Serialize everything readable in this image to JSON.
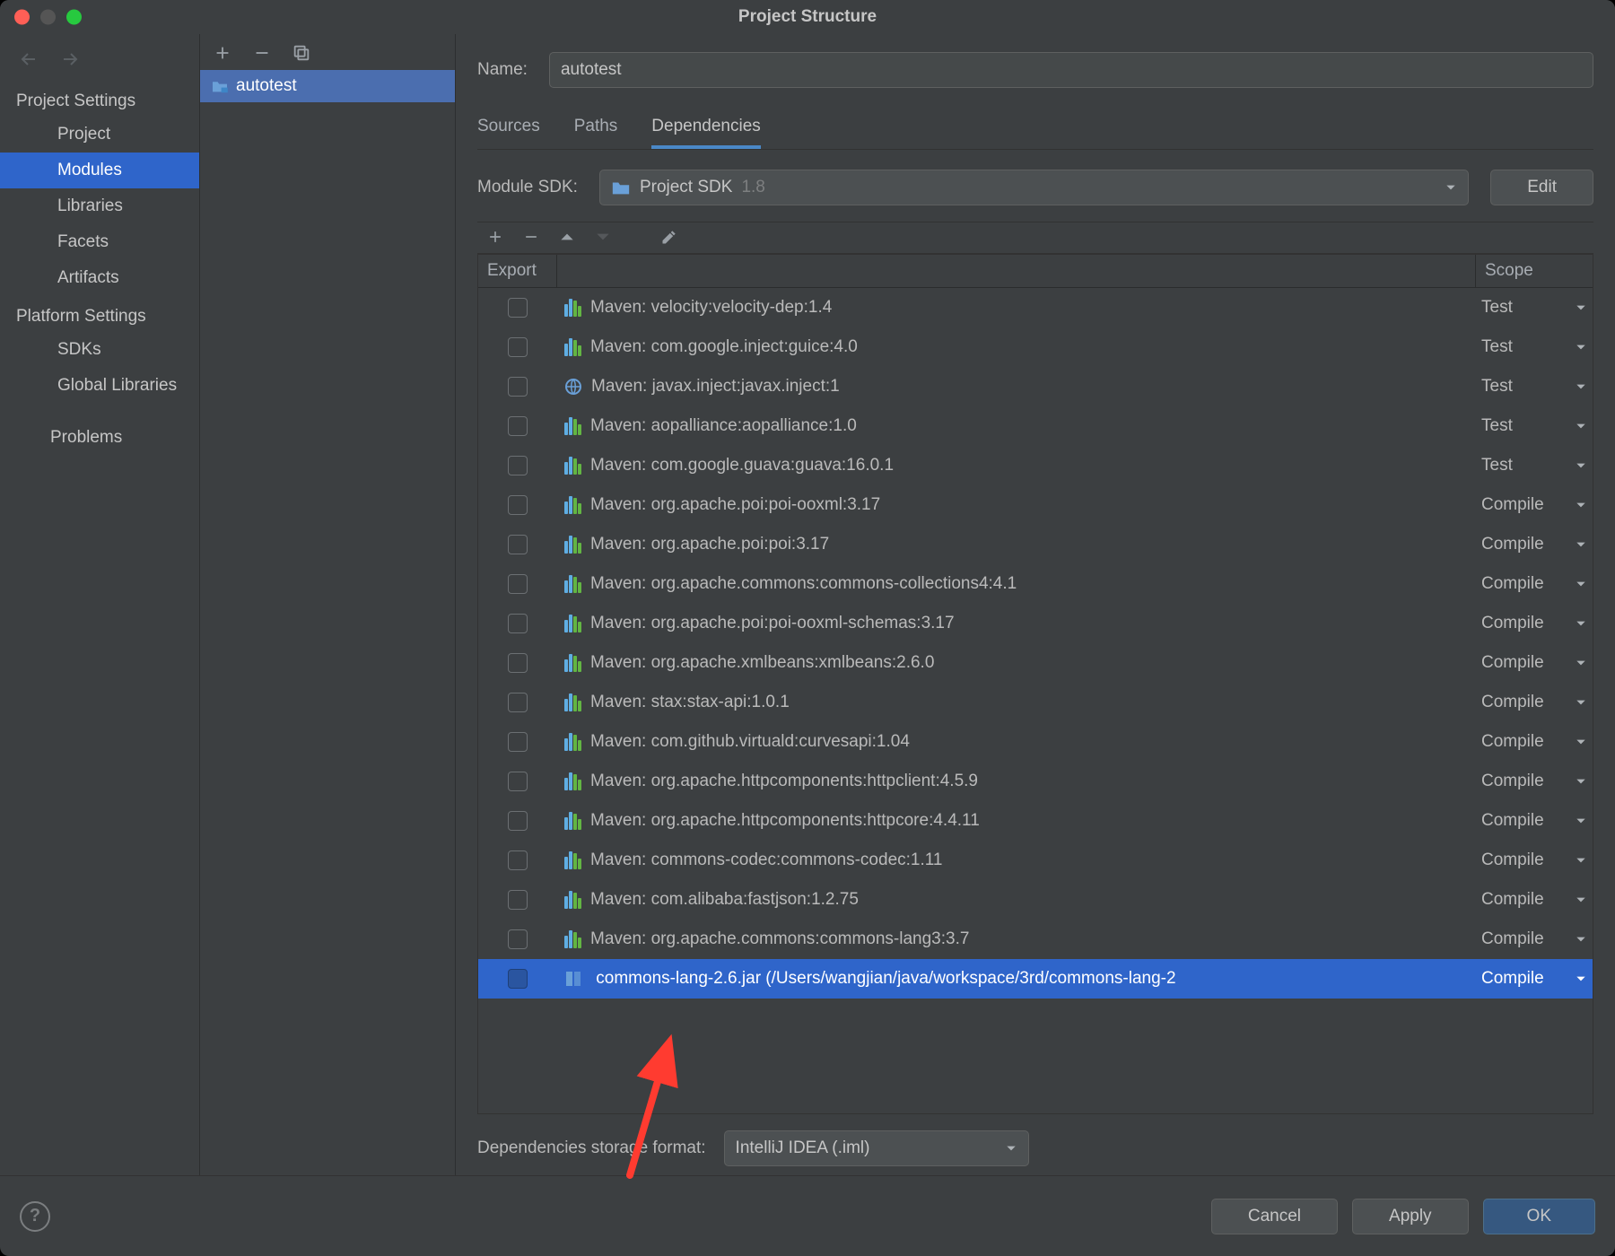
{
  "window_title": "Project Structure",
  "left_nav": {
    "project_settings_label": "Project Settings",
    "project": "Project",
    "modules": "Modules",
    "libraries": "Libraries",
    "facets": "Facets",
    "artifacts": "Artifacts",
    "platform_settings_label": "Platform Settings",
    "sdks": "SDKs",
    "global_libraries": "Global Libraries",
    "problems": "Problems"
  },
  "module_tree": {
    "module_name": "autotest"
  },
  "name_field": {
    "label": "Name:",
    "value": "autotest"
  },
  "tabs": {
    "sources": "Sources",
    "paths": "Paths",
    "dependencies": "Dependencies"
  },
  "sdk": {
    "label": "Module SDK:",
    "value": "Project SDK",
    "version": " 1.8",
    "edit_label": "Edit"
  },
  "dep_table": {
    "export_header": "Export",
    "scope_header": "Scope"
  },
  "deps": [
    {
      "name": "Maven: velocity:velocity-dep:1.4",
      "scope": "Test",
      "icon": "lib"
    },
    {
      "name": "Maven: com.google.inject:guice:4.0",
      "scope": "Test",
      "icon": "lib"
    },
    {
      "name": "Maven: javax.inject:javax.inject:1",
      "scope": "Test",
      "icon": "web"
    },
    {
      "name": "Maven: aopalliance:aopalliance:1.0",
      "scope": "Test",
      "icon": "lib"
    },
    {
      "name": "Maven: com.google.guava:guava:16.0.1",
      "scope": "Test",
      "icon": "lib"
    },
    {
      "name": "Maven: org.apache.poi:poi-ooxml:3.17",
      "scope": "Compile",
      "icon": "lib"
    },
    {
      "name": "Maven: org.apache.poi:poi:3.17",
      "scope": "Compile",
      "icon": "lib"
    },
    {
      "name": "Maven: org.apache.commons:commons-collections4:4.1",
      "scope": "Compile",
      "icon": "lib"
    },
    {
      "name": "Maven: org.apache.poi:poi-ooxml-schemas:3.17",
      "scope": "Compile",
      "icon": "lib"
    },
    {
      "name": "Maven: org.apache.xmlbeans:xmlbeans:2.6.0",
      "scope": "Compile",
      "icon": "lib"
    },
    {
      "name": "Maven: stax:stax-api:1.0.1",
      "scope": "Compile",
      "icon": "lib"
    },
    {
      "name": "Maven: com.github.virtuald:curvesapi:1.04",
      "scope": "Compile",
      "icon": "lib"
    },
    {
      "name": "Maven: org.apache.httpcomponents:httpclient:4.5.9",
      "scope": "Compile",
      "icon": "lib"
    },
    {
      "name": "Maven: org.apache.httpcomponents:httpcore:4.4.11",
      "scope": "Compile",
      "icon": "lib"
    },
    {
      "name": "Maven: commons-codec:commons-codec:1.11",
      "scope": "Compile",
      "icon": "lib"
    },
    {
      "name": "Maven: com.alibaba:fastjson:1.2.75",
      "scope": "Compile",
      "icon": "lib"
    },
    {
      "name": "Maven: org.apache.commons:commons-lang3:3.7",
      "scope": "Compile",
      "icon": "lib"
    },
    {
      "name": "commons-lang-2.6.jar (/Users/wangjian/java/workspace/3rd/commons-lang-2",
      "scope": "Compile",
      "icon": "jar",
      "selected": true
    }
  ],
  "storage": {
    "label": "Dependencies storage format:",
    "value": "IntelliJ IDEA (.iml)"
  },
  "footer": {
    "cancel": "Cancel",
    "apply": "Apply",
    "ok": "OK"
  }
}
